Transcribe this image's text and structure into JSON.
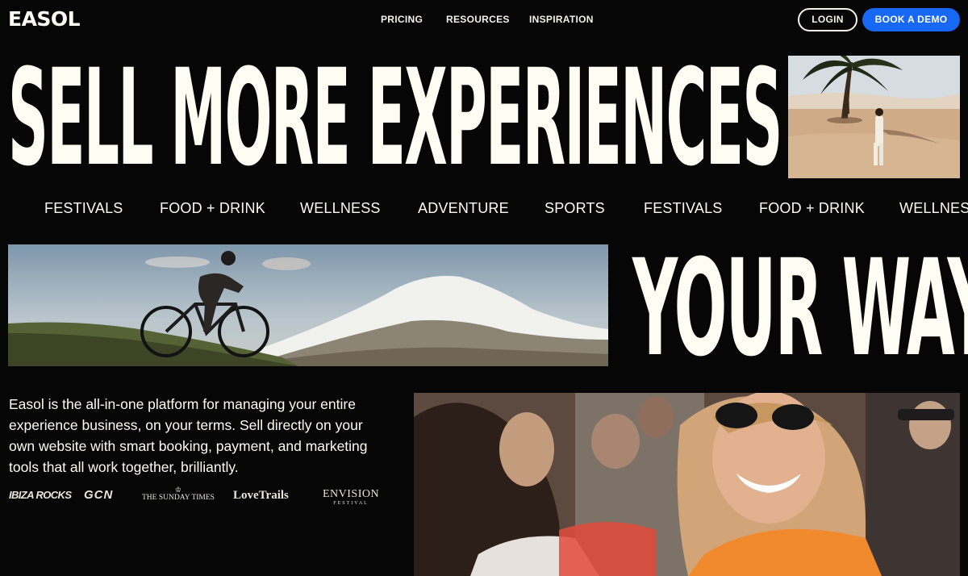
{
  "header": {
    "logo": "EASOL",
    "nav": [
      {
        "label": "PRICING"
      },
      {
        "label": "RESOURCES"
      },
      {
        "label": "INSPIRATION"
      }
    ],
    "login_label": "LOGIN",
    "demo_label": "BOOK A DEMO"
  },
  "hero": {
    "headline_1": "SELL MORE EXPERIENCES",
    "headline_2": "YOUR WAY",
    "categories": [
      "FESTIVALS",
      "FOOD + DRINK",
      "WELLNESS",
      "ADVENTURE",
      "SPORTS",
      "FESTIVALS",
      "FOOD + DRINK",
      "WELLNESS"
    ]
  },
  "intro": {
    "text": "Easol is the all-in-one platform for managing your entire experience business, on your terms. Sell directly on your own website with smart booking, payment, and marketing tools that all work together, brilliantly."
  },
  "press_logos": {
    "ibiza_rocks": "IBIZA ROCKS",
    "gcn": "GCN",
    "sunday_times": "THE SUNDAY TIMES",
    "lovetrails": "LoveTrails",
    "envision": "ENVISION",
    "envision_sub": "FESTIVAL"
  },
  "colors": {
    "background": "#060606",
    "text": "#fffcf3",
    "accent": "#1768f5"
  }
}
